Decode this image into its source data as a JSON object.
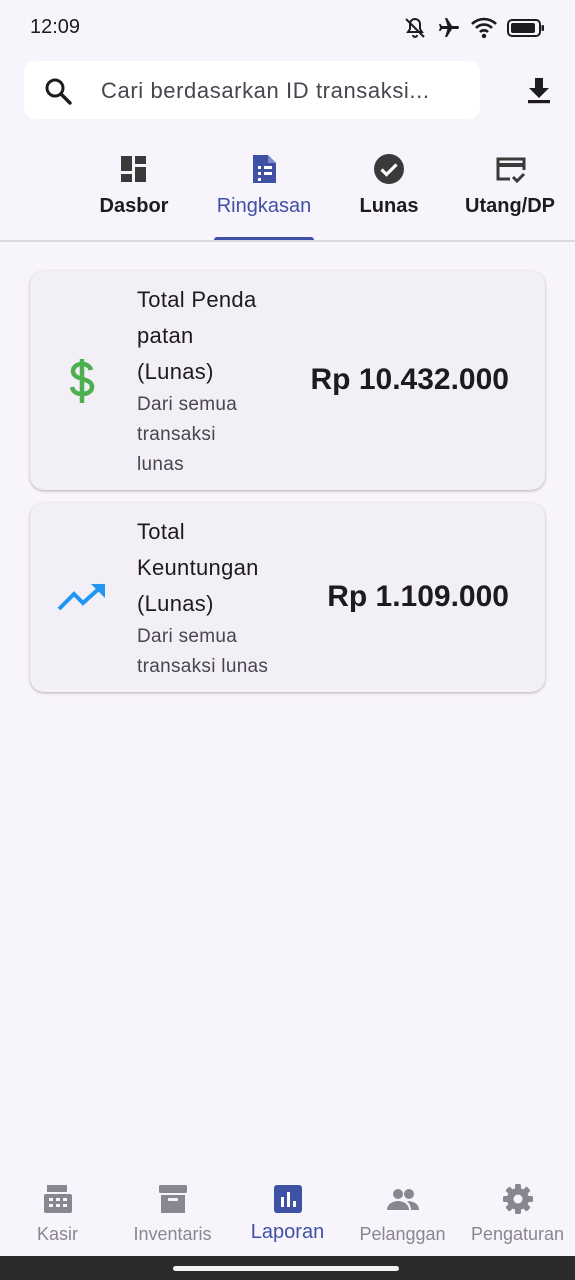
{
  "status_bar": {
    "time": "12:09"
  },
  "search": {
    "placeholder": "Cari berdasarkan ID transaksi..."
  },
  "tabs": [
    {
      "label": "Dasbor",
      "icon": "dashboard-icon"
    },
    {
      "label": "Ringkasan",
      "icon": "summary-icon",
      "active": true
    },
    {
      "label": "Lunas",
      "icon": "check-circle-icon"
    },
    {
      "label": "Utang/DP",
      "icon": "credit-card-check-icon"
    }
  ],
  "cards": [
    {
      "icon": "dollar-icon",
      "title_lines": [
        "Total Penda",
        "patan",
        "(Lunas)"
      ],
      "subtitle_lines": [
        "Dari semua",
        "transaksi",
        "lunas"
      ],
      "value": "Rp 10.432.000",
      "icon_color": "#4caf50"
    },
    {
      "icon": "trending-up-icon",
      "title_lines": [
        "Total",
        "Keuntungan",
        "(Lunas)"
      ],
      "subtitle_lines": [
        "Dari semua",
        "transaksi lunas"
      ],
      "value": "Rp 1.109.000",
      "icon_color": "#2196f3"
    }
  ],
  "bottom_nav": [
    {
      "label": "Kasir",
      "icon": "cash-register-icon"
    },
    {
      "label": "Inventaris",
      "icon": "archive-icon"
    },
    {
      "label": "Laporan",
      "icon": "bar-chart-icon",
      "active": true
    },
    {
      "label": "Pelanggan",
      "icon": "people-icon"
    },
    {
      "label": "Pengaturan",
      "icon": "gear-icon"
    }
  ],
  "colors": {
    "accent": "#3f51a5",
    "background": "#f8f4fb",
    "card": "#f3eff6"
  }
}
